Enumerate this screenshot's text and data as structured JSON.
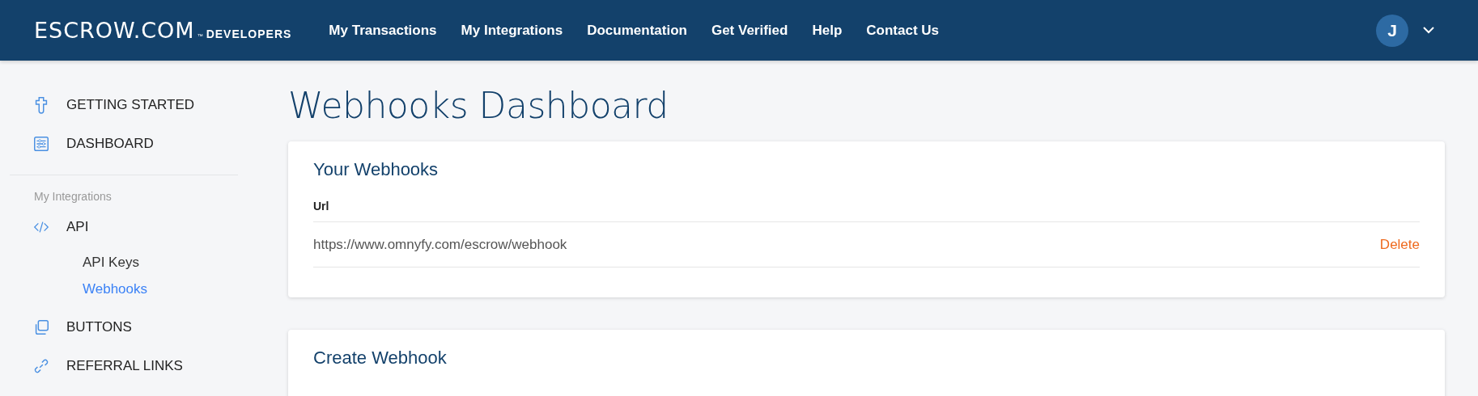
{
  "header": {
    "logo": "ESCROW.COM",
    "logo_mark": "™",
    "logo_sub": "DEVELOPERS",
    "nav": [
      "My Transactions",
      "My Integrations",
      "Documentation",
      "Get Verified",
      "Help",
      "Contact Us"
    ],
    "avatar": "J"
  },
  "sidebar": {
    "items": [
      {
        "kind": "main",
        "label": "GETTING STARTED",
        "selected": false
      },
      {
        "kind": "main",
        "label": "DASHBOARD",
        "selected": false
      },
      {
        "kind": "divider"
      },
      {
        "kind": "heading",
        "label": "My Integrations"
      },
      {
        "kind": "main",
        "label": "API",
        "selected": false
      },
      {
        "kind": "sub",
        "label": "API Keys",
        "selected": false
      },
      {
        "kind": "sub",
        "label": "Webhooks",
        "selected": true
      },
      {
        "kind": "main",
        "label": "BUTTONS",
        "selected": false
      },
      {
        "kind": "main",
        "label": "REFERRAL LINKS",
        "selected": false
      }
    ]
  },
  "page_title": "Webhooks Dashboard",
  "webhooks_card": {
    "title": "Your Webhooks",
    "column": "Url",
    "rows": [
      {
        "url": "https://www.omnyfy.com/escrow/webhook",
        "action": "Delete"
      }
    ]
  },
  "create_card": {
    "title": "Create Webhook"
  }
}
